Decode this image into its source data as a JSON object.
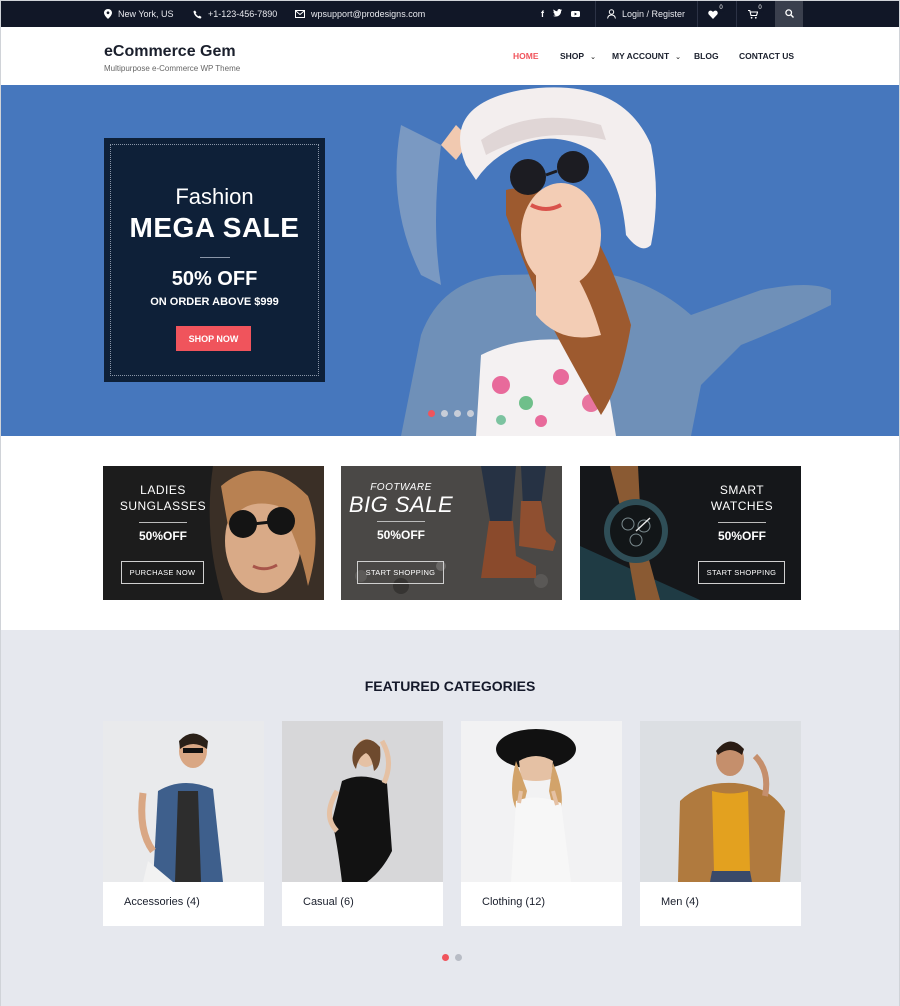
{
  "topbar": {
    "location": "New York, US",
    "phone": "+1-123-456-7890",
    "email": "wpsupport@prodesigns.com",
    "login": "Login / Register",
    "wishlist_count": "0",
    "cart_count": "0",
    "social": [
      "f",
      "t",
      "yt"
    ]
  },
  "brand": {
    "title": "eCommerce Gem",
    "tagline": "Multipurpose e-Commerce WP Theme"
  },
  "nav": {
    "items": [
      {
        "label": "HOME",
        "active": true
      },
      {
        "label": "SHOP",
        "dropdown": true
      },
      {
        "label": "MY ACCOUNT",
        "dropdown": true
      },
      {
        "label": "BLOG"
      },
      {
        "label": "CONTACT US"
      }
    ]
  },
  "hero": {
    "subtitle": "Fashion",
    "title": "MEGA SALE",
    "discount": "50% OFF",
    "condition": "ON ORDER ABOVE $999",
    "button": "SHOP NOW",
    "slides": 4,
    "active_slide": 1
  },
  "promos": [
    {
      "line1": "LADIES",
      "line2": "SUNGLASSES",
      "discount": "50%OFF",
      "button": "PURCHASE NOW"
    },
    {
      "line1": "FOOTWARE",
      "line2": "BIG SALE",
      "discount": "50%OFF",
      "button": "START SHOPPING"
    },
    {
      "line1": "SMART",
      "line2": "WATCHES",
      "discount": "50%OFF",
      "button": "START SHOPPING"
    }
  ],
  "featured": {
    "title": "FEATURED CATEGORIES",
    "categories": [
      {
        "label": "Accessories (4)"
      },
      {
        "label": "Casual (6)"
      },
      {
        "label": "Clothing (12)"
      },
      {
        "label": "Men (4)"
      }
    ],
    "pages": 2,
    "active_page": 1
  },
  "colors": {
    "accent": "#f0545c",
    "topbar": "#111727",
    "hero_bg": "#4677bd",
    "hero_card": "#0e2038",
    "featured_bg": "#e6e8ee"
  }
}
